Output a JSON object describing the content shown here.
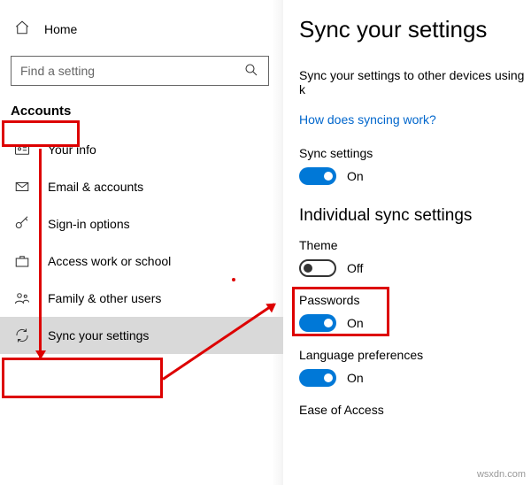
{
  "sidebar": {
    "home_label": "Home",
    "search_placeholder": "Find a setting",
    "category": "Accounts",
    "items": [
      {
        "label": "Your info"
      },
      {
        "label": "Email & accounts"
      },
      {
        "label": "Sign-in options"
      },
      {
        "label": "Access work or school"
      },
      {
        "label": "Family & other users"
      },
      {
        "label": "Sync your settings"
      }
    ]
  },
  "content": {
    "title": "Sync your settings",
    "description": "Sync your settings to other devices using k",
    "help_link": "How does syncing work?",
    "sync_settings_label": "Sync settings",
    "sync_settings_state": "On",
    "subheading": "Individual sync settings",
    "individual": [
      {
        "label": "Theme",
        "state": "Off"
      },
      {
        "label": "Passwords",
        "state": "On"
      },
      {
        "label": "Language preferences",
        "state": "On"
      },
      {
        "label": "Ease of Access",
        "state": ""
      }
    ]
  },
  "watermark": "wsxdn.com",
  "colors": {
    "accent": "#0078d7",
    "anno": "#d00",
    "link": "#0066cc"
  }
}
